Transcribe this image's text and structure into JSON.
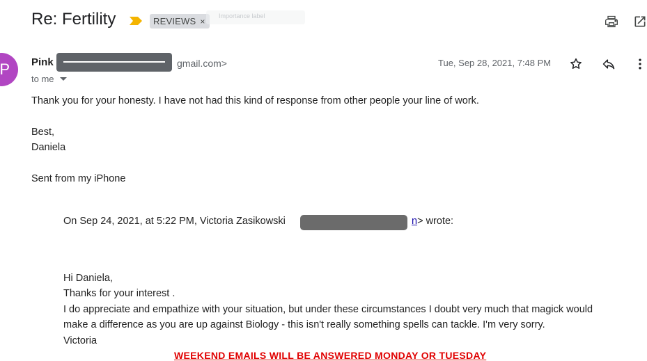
{
  "header": {
    "subject": "Re: Fertility",
    "label": "REVIEWS",
    "label_remove": "×",
    "faded_chip_text": "Importance label"
  },
  "icons": {
    "importance": "importance-marker-icon",
    "print": "print-icon",
    "new_window": "open-in-new-window-icon",
    "star": "star-icon",
    "reply": "reply-icon",
    "more": "more-vert-icon"
  },
  "colors": {
    "importance": "#f4b400",
    "avatar": "#b146c2",
    "link": "#1a0dab",
    "notice": "#e00000",
    "redaction": "#5f6368"
  },
  "message": {
    "avatar_letter": "P",
    "sender_name_prefix": "Pink",
    "sender_domain": "gmail.com>",
    "recipient": "to me",
    "date": "Tue, Sep 28, 2021, 7:48 PM",
    "body": [
      "Thank you for your honesty. I have not had this kind of response from other people your line of work.",
      "Best,",
      "Daniela",
      "Sent from my iPhone"
    ],
    "quote_header_prefix": "On Sep 24, 2021, at 5:22 PM, Victoria Zasikowski",
    "quote_header_link": "n",
    "quote_header_suffix": "> wrote:",
    "quoted_body": [
      "Hi Daniela,",
      "Thanks for your interest .",
      "I do appreciate and empathize with your situation, but under these circumstances I doubt very much that magick would",
      "make a difference as you are up against Biology - this isn't really something spells can tackle. I'm very sorry.",
      "Victoria"
    ],
    "footer_notice": "WEEKEND EMAILS WILL BE ANSWERED MONDAY OR TUESDAY"
  }
}
